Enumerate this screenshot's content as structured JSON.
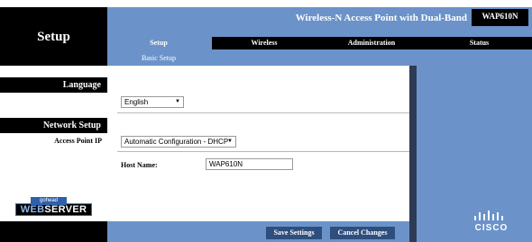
{
  "header": {
    "title": "Setup",
    "product": "Wireless-N Access Point with Dual-Band",
    "model": "WAP610N"
  },
  "tabs": [
    {
      "label": "Setup"
    },
    {
      "label": "Wireless"
    },
    {
      "label": "Administration"
    },
    {
      "label": "Status"
    }
  ],
  "subtab": {
    "label": "Basic Setup"
  },
  "sidebar": {
    "language": "Language",
    "network_setup": "Network Setup",
    "access_point_ip": "Access Point IP"
  },
  "form": {
    "language_value": "English",
    "ip_mode_value": "Automatic Configuration - DHCP",
    "host_name_label": "Host Name:",
    "host_name_value": "WAP610N"
  },
  "buttons": {
    "save": "Save Settings",
    "cancel": "Cancel Changes"
  },
  "logos": {
    "gohead": "gohead",
    "web": "WEB",
    "server": "SERVER",
    "cisco": "CISCO"
  },
  "colors": {
    "blue": "#6b93c9",
    "black": "#000000",
    "button": "#2e4e7e"
  }
}
